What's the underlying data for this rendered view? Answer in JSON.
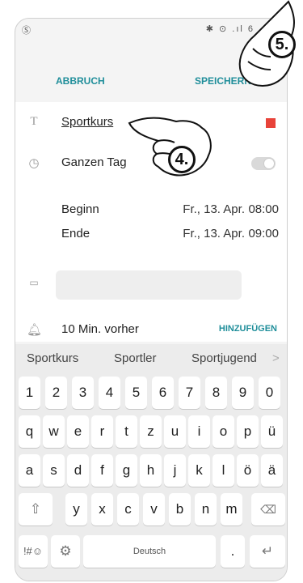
{
  "statusbar": {
    "left": "Ⓢ",
    "right": "✱ ⊙ .ıl 6"
  },
  "topbar": {
    "cancel": "ABBRUCH",
    "save": "SPEICHERN"
  },
  "event": {
    "title": "Sportkurs",
    "color": "#e8433a",
    "allday_label": "Ganzen Tag",
    "begin_label": "Beginn",
    "begin_date": "Fr., 13. Apr.",
    "begin_time": "08:00",
    "end_label": "Ende",
    "end_date": "Fr., 13. Apr.",
    "end_time": "09:00",
    "reminder": "10 Min. vorher",
    "add_label": "HINZUFÜGEN"
  },
  "suggestions": [
    "Sportkurs",
    "Sportler",
    "Sportjugend"
  ],
  "keyboard": {
    "row_numbers": [
      "1",
      "2",
      "3",
      "4",
      "5",
      "6",
      "7",
      "8",
      "9",
      "0"
    ],
    "row_q": [
      "q",
      "w",
      "e",
      "r",
      "t",
      "z",
      "u",
      "i",
      "o",
      "p",
      "ü"
    ],
    "row_a": [
      "a",
      "s",
      "d",
      "f",
      "g",
      "h",
      "j",
      "k",
      "l",
      "ö",
      "ä"
    ],
    "row_y": [
      "y",
      "x",
      "c",
      "v",
      "b",
      "n",
      "m"
    ],
    "space_label": "Deutsch",
    "sym_label": "!#☺",
    "period": "."
  },
  "annotations": {
    "step4": "4.",
    "step5": "5."
  }
}
